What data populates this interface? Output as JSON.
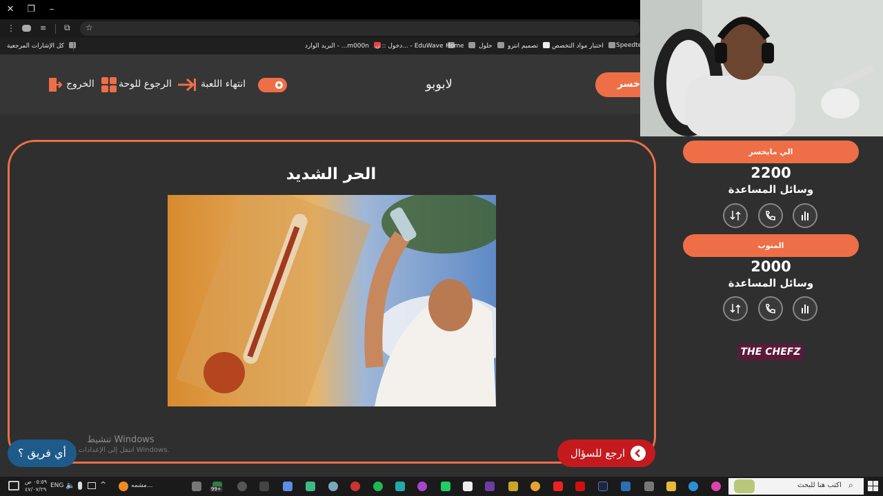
{
  "browser": {
    "bookmarks": [
      {
        "label": "Speedtest"
      },
      {
        "label": "اختبار مواد التخصص"
      },
      {
        "label": "تصميم انترو"
      },
      {
        "label": "حلول"
      },
      {
        "label": "Home"
      },
      {
        "label": "دخول :: ن... - EduWave"
      },
      {
        "label": "البريد الوارد - ...m000n"
      }
    ],
    "all_bookmarks_label": "كل الإشارات المرجعية"
  },
  "header": {
    "game_name": "لابوبو",
    "end_game_label": "انتهاء اللعبة",
    "back_to_board_label": "الرجوع للوحة",
    "exit_label": "الخروج",
    "active_team_partial": "خسر"
  },
  "question": {
    "title": "الحر الشديد",
    "back_to_question_label": "ارجع للسؤال",
    "which_team_label": "أي فريق ؟"
  },
  "teams": [
    {
      "name": "الي مايخسر",
      "score": "2200",
      "aids_label": "وسائل المساعدة"
    },
    {
      "name": "المنوب",
      "score": "2000",
      "aids_label": "وسائل المساعدة"
    }
  ],
  "brand": {
    "logo_text": "THE CHEFZ"
  },
  "watermark": {
    "line1": "تنشيط Windows",
    "line2": "انتقل إلى الإعدادات لتنشيط Windows."
  },
  "taskbar": {
    "search_placeholder": "اكتب هنا للبحث",
    "language": "ENG",
    "time": "٠٥:٥٩ ص",
    "date": "٤٧/٠٧/٢٩",
    "badge": "99+",
    "tray_app_label": "مشمه..."
  },
  "colors": {
    "accent": "#ee6f47",
    "background": "#2f2f2f",
    "back_button": "#c41a1e",
    "team_button": "#1e5a8a"
  }
}
